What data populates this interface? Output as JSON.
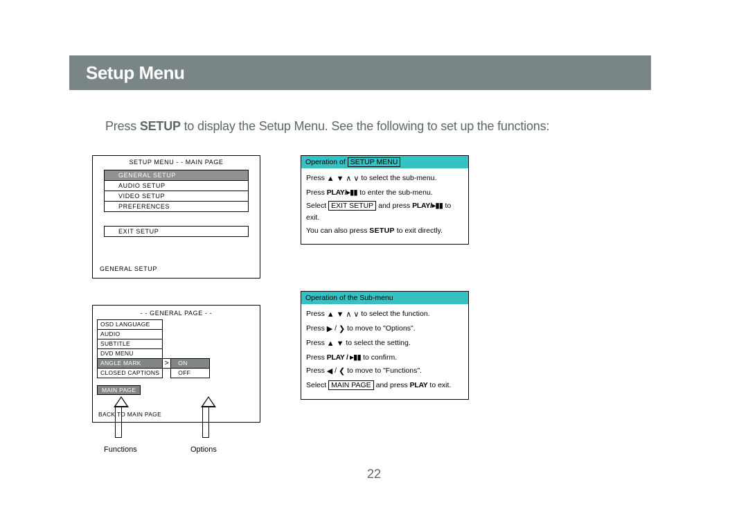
{
  "header": {
    "title": "Setup Menu"
  },
  "intro": {
    "pre": "Press ",
    "bold": "SETUP",
    "post": " to display the Setup Menu. See the following to set up the functions:"
  },
  "mainpage": {
    "title": "SETUP MENU - - MAIN PAGE",
    "items": [
      {
        "label": "GENERAL SETUP",
        "selected": true
      },
      {
        "label": "AUDIO SETUP",
        "selected": false
      },
      {
        "label": "VIDEO SETUP",
        "selected": false
      },
      {
        "label": "PREFERENCES",
        "selected": false
      }
    ],
    "exit": "EXIT SETUP",
    "footer": "GENERAL SETUP"
  },
  "generalpage": {
    "title": "- - GENERAL PAGE - -",
    "rows": [
      {
        "label": "OSD LANGUAGE",
        "opt": ""
      },
      {
        "label": "AUDIO",
        "opt": ""
      },
      {
        "label": "SUBTITLE",
        "opt": ""
      },
      {
        "label": "DVD MENU",
        "opt": ""
      },
      {
        "label": "ANGLE MARK",
        "opt": "ON",
        "selected": true,
        "arrow": ">"
      },
      {
        "label": "CLOSED CAPTIONS",
        "opt": "OFF"
      }
    ],
    "mainpage": "MAIN PAGE",
    "footer": "BACK TO MAIN PAGE"
  },
  "arrowlabels": {
    "functions": "Functions",
    "options": "Options"
  },
  "op1": {
    "header_pre": "Operation of ",
    "header_box": "SETUP MENU",
    "l1_a": "Press ",
    "l1_b": " to select the sub-menu.",
    "l2_a": "Press ",
    "l2_play": "PLAY/▸▮▮",
    "l2_b": " to enter the sub-menu.",
    "l3_a": "Select ",
    "l3_box": "EXIT SETUP",
    "l3_b": " and press ",
    "l3_play": "PLAY/▸▮▮",
    "l3_c": " to exit.",
    "l4_a": "You can also press ",
    "l4_setup": "SETUP",
    "l4_b": " to exit directly."
  },
  "op2": {
    "header": "Operation of the Sub-menu",
    "l1_a": "Press ",
    "l1_b": " to select the function.",
    "l2_a": "Press ",
    "l2_b": " to move to \"Options\".",
    "l3_a": "Press ",
    "l3_b": " to select the setting.",
    "l4_a": "Press ",
    "l4_play": "PLAY / ▸▮▮",
    "l4_b": " to confirm.",
    "l5_a": "Press ",
    "l5_b": " to move to \"Functions\".",
    "l6_a": "Select ",
    "l6_box": "MAIN PAGE",
    "l6_b": " and press ",
    "l6_play": "PLAY",
    "l6_c": " to exit."
  },
  "glyphs": {
    "solid_up": "▲",
    "solid_down": "▼",
    "chev_up": "∧",
    "chev_down": "∨",
    "solid_right": "▶",
    "chev_right": "❯",
    "solid_left": "◀",
    "chev_left": "❮"
  },
  "pagenum": "22"
}
